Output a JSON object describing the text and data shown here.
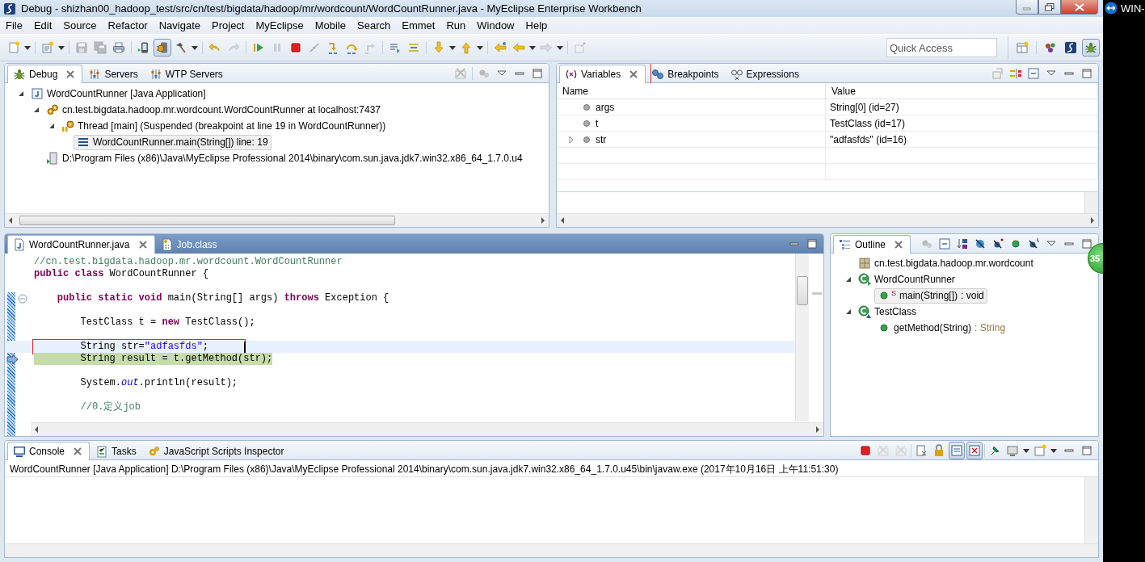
{
  "window": {
    "title": "Debug - shizhan00_hadoop_test/src/cn/test/bigdata/hadoop/mr/wordcount/WordCountRunner.java - MyEclipse Enterprise Workbench"
  },
  "menu": [
    "File",
    "Edit",
    "Source",
    "Refactor",
    "Navigate",
    "Project",
    "MyEclipse",
    "Mobile",
    "Search",
    "Emmet",
    "Run",
    "Window",
    "Help"
  ],
  "toolbar": [
    {
      "pressed": false,
      "disabled": false
    },
    {
      "pressed": false,
      "disabled": false
    },
    {
      "pressed": false,
      "disabled": true
    },
    {
      "pressed": false,
      "disabled": true
    },
    {
      "pressed": false,
      "disabled": false
    },
    {
      "pressed": false,
      "disabled": false
    },
    {
      "pressed": true,
      "disabled": false
    },
    {
      "pressed": false,
      "disabled": false
    },
    {
      "pressed": false,
      "disabled": false
    },
    {
      "pressed": false,
      "disabled": true
    },
    {
      "pressed": false,
      "disabled": false
    },
    {
      "pressed": false,
      "disabled": true
    },
    {
      "pressed": false,
      "disabled": false
    },
    {
      "pressed": false,
      "disabled": true
    },
    {
      "pressed": false,
      "disabled": false
    },
    {
      "pressed": false,
      "disabled": false
    },
    {
      "pressed": false,
      "disabled": true
    },
    {
      "pressed": false,
      "disabled": false
    },
    {
      "pressed": false,
      "disabled": false
    },
    {
      "pressed": false,
      "disabled": false
    },
    {
      "pressed": false,
      "disabled": false
    },
    {
      "pressed": false,
      "disabled": false
    },
    {
      "pressed": false,
      "disabled": false
    },
    {
      "pressed": false,
      "disabled": true
    },
    {
      "pressed": false,
      "disabled": true
    }
  ],
  "quick_access": {
    "placeholder": "Quick Access"
  },
  "perspectives": [
    {
      "selected": false
    },
    {
      "selected": false
    },
    {
      "selected": true
    }
  ],
  "debug_view": {
    "tabs": [
      {
        "label": "Debug",
        "selected": true
      },
      {
        "label": "Servers",
        "selected": false
      },
      {
        "label": "WTP Servers",
        "selected": false
      }
    ],
    "tree": [
      {
        "label": "WordCountRunner [Java Application]",
        "kind": "launch",
        "expanded": true,
        "selected": false,
        "children": [
          {
            "label": "cn.test.bigdata.hadoop.mr.wordcount.WordCountRunner at localhost:7437",
            "kind": "target",
            "expanded": true,
            "selected": false,
            "children": [
              {
                "label": "Thread [main] (Suspended (breakpoint at line 19 in WordCountRunner))",
                "kind": "thread",
                "expanded": true,
                "selected": false,
                "children": [
                  {
                    "label": "WordCountRunner.main(String[]) line: 19",
                    "kind": "frame",
                    "selected": true
                  }
                ]
              }
            ]
          },
          {
            "label": "D:\\Program Files (x86)\\Java\\MyEclipse Professional 2014\\binary\\com.sun.java.jdk7.win32.x86_64_1.7.0.u4",
            "kind": "process",
            "selected": false
          }
        ]
      }
    ]
  },
  "variables_view": {
    "tabs": [
      {
        "label": "Variables",
        "selected": true,
        "annotated": true
      },
      {
        "label": "Breakpoints",
        "selected": false,
        "annotated": false
      },
      {
        "label": "Expressions",
        "selected": false,
        "annotated": false
      }
    ],
    "columns": [
      "Name",
      "Value"
    ],
    "rows": [
      {
        "name": "args",
        "value": "String[0]  (id=27)"
      },
      {
        "name": "t",
        "value": "TestClass  (id=17)"
      },
      {
        "name": "str",
        "value": "\"adfasfds\" (id=16)",
        "expanded": false
      }
    ]
  },
  "editor": {
    "tabs": [
      {
        "label": "WordCountRunner.java",
        "selected": true
      },
      {
        "label": "Job.class",
        "selected": false
      }
    ],
    "lines": [
      {
        "current": false,
        "execution": false,
        "tokens": [
          {
            "text": "//cn.test.bigdata.hadoop.mr.wordcount.WordCountRunner",
            "kind": "comment"
          }
        ]
      },
      {
        "current": false,
        "execution": false,
        "tokens": [
          {
            "text": "public class",
            "kind": "keyword"
          },
          {
            "text": " WordCountRunner {",
            "kind": "plain"
          }
        ]
      },
      {
        "current": false,
        "execution": false
      },
      {
        "current": false,
        "execution": false,
        "foldable": true,
        "tokens": [
          {
            "text": "    public static void",
            "kind": "keyword"
          },
          {
            "text": " main(String[] args) ",
            "kind": "plain"
          },
          {
            "text": "throws",
            "kind": "keyword"
          },
          {
            "text": " Exception {",
            "kind": "plain"
          }
        ]
      },
      {
        "current": false,
        "execution": false
      },
      {
        "current": false,
        "execution": false,
        "tokens": [
          {
            "text": "        TestClass t = ",
            "kind": "plain"
          },
          {
            "text": "new",
            "kind": "keyword"
          },
          {
            "text": " TestClass();",
            "kind": "plain"
          }
        ]
      },
      {
        "current": false,
        "execution": false
      },
      {
        "current": true,
        "execution": false,
        "annotated": true,
        "tokens": [
          {
            "text": "        String str=",
            "kind": "plain"
          },
          {
            "text": "\"adfasfds\"",
            "kind": "string"
          },
          {
            "text": ";",
            "kind": "plain"
          }
        ]
      },
      {
        "current": false,
        "execution": true,
        "tokens": [
          {
            "text": "        String result = t.getMethod(str);",
            "kind": "plain"
          }
        ]
      },
      {
        "current": false,
        "execution": false
      },
      {
        "current": false,
        "execution": false,
        "tokens": [
          {
            "text": "        System.",
            "kind": "plain"
          },
          {
            "text": "out",
            "kind": "field"
          },
          {
            "text": ".println(result);",
            "kind": "plain"
          }
        ]
      },
      {
        "current": false,
        "execution": false
      },
      {
        "current": false,
        "execution": false,
        "tokens": [
          {
            "text": "        //0.定义job",
            "kind": "comment"
          }
        ]
      }
    ]
  },
  "outline": {
    "tabs": [
      {
        "label": "Outline",
        "selected": true
      }
    ],
    "tree": [
      {
        "label": "cn.test.bigdata.hadoop.mr.wordcount",
        "kind": "package",
        "selected": false
      },
      {
        "label": "WordCountRunner",
        "kind": "main_class",
        "expanded": true,
        "selected": false,
        "children": [
          {
            "label": "main(String[])",
            "return_type": " : void",
            "modifier": "S",
            "kind": "method",
            "selected": true
          }
        ]
      },
      {
        "label": "TestClass",
        "kind": "class",
        "expanded": true,
        "selected": false,
        "children": [
          {
            "label": "getMethod(String)",
            "return_type": " : String",
            "kind": "method",
            "selected": false
          }
        ]
      }
    ]
  },
  "console": {
    "tabs": [
      {
        "label": "Console",
        "selected": true
      },
      {
        "label": "Tasks",
        "selected": false
      },
      {
        "label": "JavaScript Scripts Inspector",
        "selected": false
      }
    ],
    "toolbar": [
      {
        "pressed": false,
        "disabled": false
      },
      {
        "pressed": false,
        "disabled": true
      },
      {
        "pressed": false,
        "disabled": true
      },
      {
        "pressed": false,
        "disabled": false
      },
      {
        "pressed": false,
        "disabled": false
      },
      {
        "pressed": true,
        "disabled": false
      },
      {
        "pressed": true,
        "disabled": false
      },
      {
        "pressed": false,
        "disabled": false
      }
    ],
    "process": "WordCountRunner [Java Application] D:\\Program Files (x86)\\Java\\MyEclipse Professional 2014\\binary\\com.sun.java.jdk7.win32.x86_64_1.7.0.u45\\bin\\javaw.exe (2017年10月16日 上午11:51:30)"
  },
  "notification_badge": "35",
  "side_strip": {
    "label": "WIN-"
  }
}
